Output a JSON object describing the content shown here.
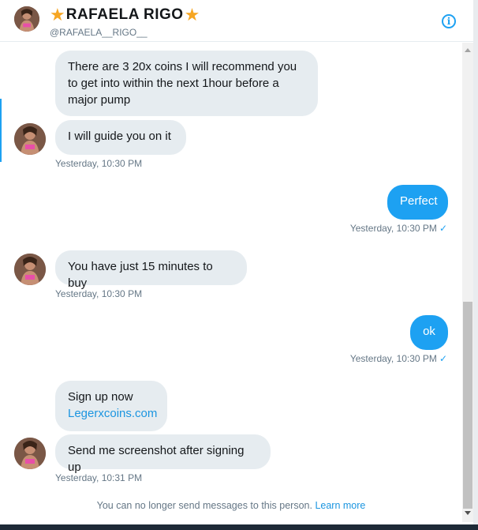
{
  "header": {
    "title": "RAFAELA RIGO",
    "star": "★",
    "handle": "@RAFAELA__RIGO__",
    "info_icon": "info-icon",
    "info_glyph": "i"
  },
  "messages": [
    {
      "text": "There are 3 20x coins I will recommend you to get into within the next 1hour before a major pump"
    },
    {
      "text": "I will guide you on it",
      "time": "Yesterday, 10:30 PM"
    },
    {
      "text": "Perfect",
      "time": "Yesterday, 10:30 PM"
    },
    {
      "text": "You have just 15 minutes to buy",
      "time": "Yesterday, 10:30 PM"
    },
    {
      "text": "ok",
      "time": "Yesterday, 10:30 PM"
    },
    {
      "text": "Sign up now",
      "link": "Legerxcoins.com"
    },
    {
      "text": "Send me screenshot after signing up",
      "time": "Yesterday, 10:31 PM"
    }
  ],
  "check_glyph": "✓",
  "footer": {
    "note": "You can no longer send messages to this person.",
    "learn_more": "Learn more"
  },
  "colors": {
    "accent": "#1da1f2",
    "incoming_bubble": "#e6ecf0",
    "muted_text": "#657786"
  }
}
